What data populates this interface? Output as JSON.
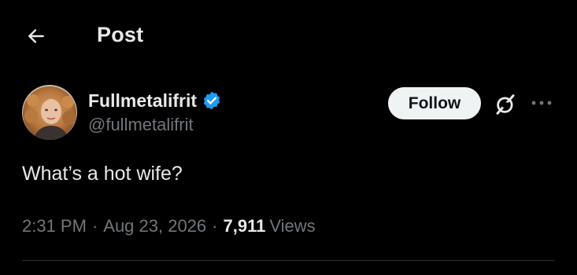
{
  "header": {
    "title": "Post",
    "back_icon": "arrow-left-icon"
  },
  "author": {
    "display_name": "Fullmetalifrit",
    "handle": "@fullmetalifrit",
    "verified": true,
    "verified_color": "#1d9bf0",
    "avatar_icon": "avatar-photo"
  },
  "actions": {
    "follow_label": "Follow",
    "grok_icon": "grok-icon",
    "more_icon": "more-horizontal-icon"
  },
  "tweet": {
    "text": "What’s a hot wife?"
  },
  "meta": {
    "time": "2:31 PM",
    "date": "Aug 23, 2026",
    "separator": "·",
    "views_count": "7,911",
    "views_label": "Views"
  },
  "colors": {
    "background": "#000000",
    "primary_text": "#e7e9ea",
    "secondary_text": "#71767b",
    "divider": "#2f3336",
    "follow_bg": "#eff3f4"
  }
}
